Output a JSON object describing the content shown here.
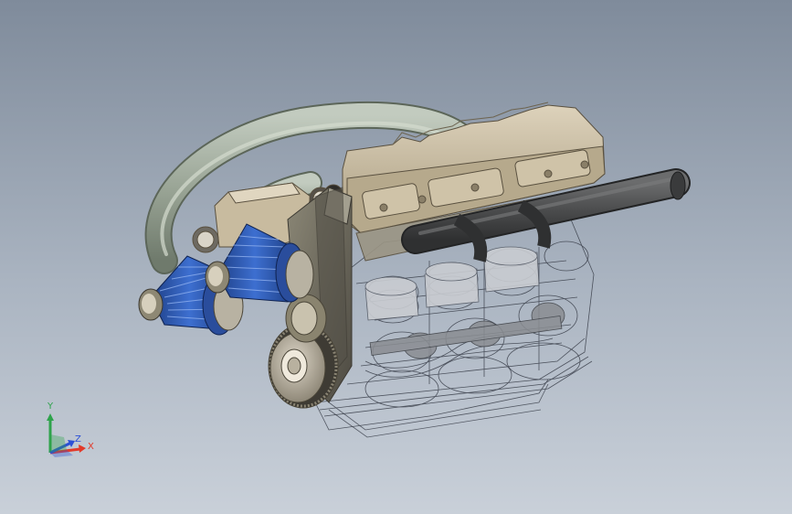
{
  "viewport": {
    "background_top": "#7f8b9b",
    "background_bottom": "#c9d0d9"
  },
  "model": {
    "head_color": "#c8bb9f",
    "filter_color": "#2f5fb8",
    "tube_color": "#9aa596",
    "pipe_color": "#4e4f50",
    "wire_color": "#3a3f4a"
  },
  "triad": {
    "x_label": "X",
    "y_label": "Y",
    "z_label": "Z",
    "x_color": "#e23a2a",
    "y_color": "#2ea34b",
    "z_color": "#2b4fd6"
  }
}
